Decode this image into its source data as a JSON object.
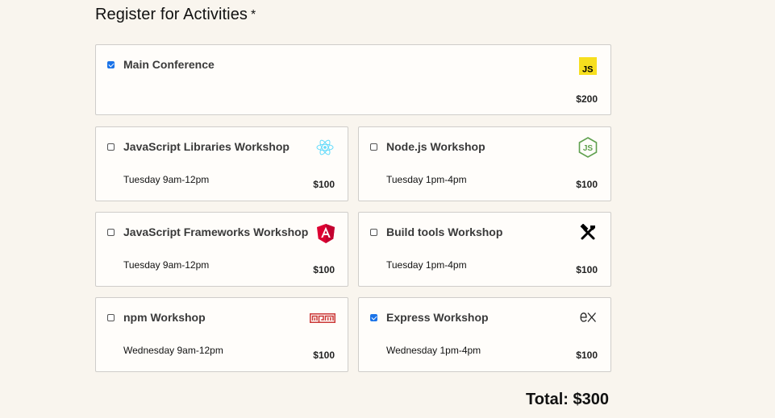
{
  "section": {
    "title": "Register for Activities",
    "required_mark": "*"
  },
  "activities": [
    {
      "name": "Main Conference",
      "time": "",
      "price": "$200",
      "checked": true,
      "icon": "javascript-icon"
    },
    {
      "name": "JavaScript Libraries Workshop",
      "time": "Tuesday 9am-12pm",
      "price": "$100",
      "checked": false,
      "icon": "react-icon"
    },
    {
      "name": "Node.js Workshop",
      "time": "Tuesday 1pm-4pm",
      "price": "$100",
      "checked": false,
      "icon": "nodejs-icon"
    },
    {
      "name": "JavaScript Frameworks Workshop",
      "time": "Tuesday 9am-12pm",
      "price": "$100",
      "checked": false,
      "icon": "angular-icon"
    },
    {
      "name": "Build tools Workshop",
      "time": "Tuesday 1pm-4pm",
      "price": "$100",
      "checked": false,
      "icon": "build-tools-icon"
    },
    {
      "name": "npm Workshop",
      "time": "Wednesday 9am-12pm",
      "price": "$100",
      "checked": false,
      "icon": "npm-icon"
    },
    {
      "name": "Express Workshop",
      "time": "Wednesday 1pm-4pm",
      "price": "$100",
      "checked": true,
      "icon": "express-icon"
    }
  ],
  "total": {
    "label": "Total: $300"
  },
  "colors": {
    "background": "#f9f5ee",
    "card_background": "#fffdfa",
    "checkbox_checked": "#1a73e8",
    "js_yellow": "#f7df1e",
    "react_cyan": "#61dafb",
    "node_green": "#5fa04e",
    "angular_red": "#dd0031",
    "npm_red": "#cb3837"
  }
}
